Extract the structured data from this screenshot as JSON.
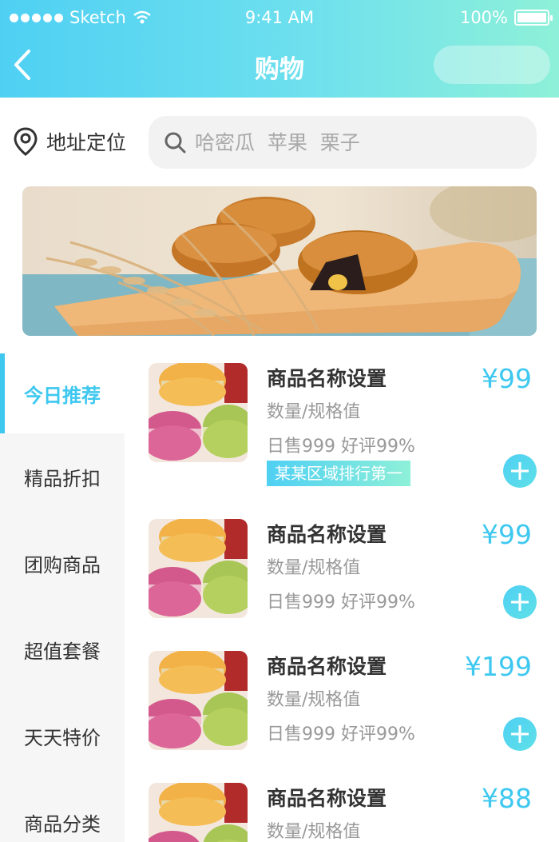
{
  "status_bar": {
    "carrier": "Sketch",
    "time": "9:41 AM",
    "battery": "100%"
  },
  "nav": {
    "title": "购物"
  },
  "location": {
    "label": "地址定位"
  },
  "search": {
    "placeholder": "哈密瓜  苹果  栗子"
  },
  "sidebar": {
    "items": [
      {
        "label": "今日推荐",
        "active": true
      },
      {
        "label": "精品折扣"
      },
      {
        "label": "团购商品"
      },
      {
        "label": "超值套餐"
      },
      {
        "label": "天天特价"
      },
      {
        "label": "商品分类"
      }
    ]
  },
  "products": [
    {
      "name": "商品名称设置",
      "spec": "数量/规格值",
      "sales": "日售999  好评99%",
      "tag": "某某区域排行第一",
      "price": "¥99"
    },
    {
      "name": "商品名称设置",
      "spec": "数量/规格值",
      "sales": "日售999  好评99%",
      "price": "¥99"
    },
    {
      "name": "商品名称设置",
      "spec": "数量/规格值",
      "sales": "日售999  好评99%",
      "price": "¥199"
    },
    {
      "name": "商品名称设置",
      "spec": "数量/规格值",
      "price": "¥88"
    }
  ],
  "colors": {
    "accent": "#3ec8f0",
    "header_start": "#4fd0f3",
    "header_end": "#8ef0d8"
  },
  "icons": [
    "chevron-left-icon",
    "location-pin-icon",
    "search-icon",
    "plus-icon",
    "wifi-icon",
    "battery-icon"
  ]
}
